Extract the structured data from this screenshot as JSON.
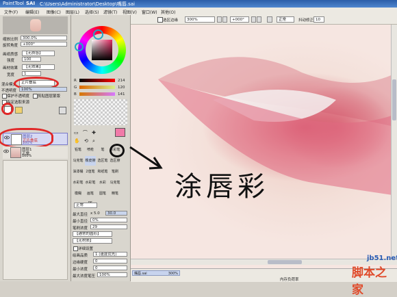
{
  "window": {
    "app": "PaintTool",
    "logo": "SAI",
    "title": "C:\\Users\\Administrator\\Desktop\\嘴唇.sai"
  },
  "menu": [
    "文件(F)",
    "编辑(E)",
    "图像(C)",
    "图层(L)",
    "选择(S)",
    "滤镜(T)",
    "视图(V)",
    "窗口(W)",
    "其他(O)"
  ],
  "toolbar": {
    "selection_check": "选区边缘",
    "zoom": "300%",
    "angle": "+000°",
    "mode": "正常",
    "stabilizer_label": "抖动修正",
    "stabilizer": "10"
  },
  "navigator": {
    "zoom_label": "缩放比例",
    "zoom_value": "300.0%",
    "angle_label": "旋转角度",
    "angle_value": "+000°"
  },
  "layer_props": {
    "paper_label": "画纸质感",
    "paper_value": "【无质感】",
    "strength_label": "强度",
    "strength_value": "100",
    "effect_label": "画材效果",
    "effect_value": "【无效果】",
    "width_label": "宽度",
    "width_value": "1",
    "blend_label": "混合模式",
    "blend_value": "正片叠底",
    "opacity_label": "不透明度",
    "opacity_value": "100%",
    "protect_label": "保护不透明度",
    "clip_label": "剪贴图层蒙版",
    "ref_label": "指定选取来源"
  },
  "layers": [
    {
      "name": "图层2",
      "mode": "正片叠底",
      "opacity": "100%"
    },
    {
      "name": "图层1",
      "mode": "正常",
      "opacity": "100%"
    }
  ],
  "color": {
    "accent": "#e05070",
    "r_label": "R",
    "r_value": "214",
    "g_label": "G",
    "g_value": "120",
    "b_label": "B",
    "b_value": "141"
  },
  "tools": [
    "铅笔",
    "喷枪",
    "笔",
    "水彩笔",
    "马克笔",
    "橡皮擦",
    "选区笔",
    "选区擦",
    "油漆桶",
    "2值笔",
    "和纸笔",
    "笔刷",
    "水彩笔",
    "水彩笔",
    "水彩",
    "马克笔",
    "模糊",
    "画笔PS",
    "圆笔",
    "精笔"
  ],
  "brush": {
    "mode_value": "正常",
    "size_label": "最大直径",
    "size_mult": "x 5.0",
    "size_value": "30.0",
    "min_label": "最小直径",
    "min_value": "0%",
    "density_label": "笔刷浓度",
    "density_value": "29",
    "shape_value": "【通常的圆形】",
    "texture_value": "【无材质】",
    "detail_label": "详细设置",
    "quality_label": "绘画品质",
    "quality_value": "1 (速度优先)",
    "edge_label": "边缘硬度",
    "edge_value": "0",
    "min_density_label": "最小浓度",
    "min_density_value": "0",
    "max_density_label": "最大浓度笔压",
    "max_density_value": "100%"
  },
  "status": {
    "file": "嘴唇.sai",
    "zoom": "300%",
    "memory": "内存负荷率"
  },
  "annotation": {
    "text": "涂唇彩"
  },
  "watermark": {
    "site": "jb51.net",
    "brand": "脚本之家"
  }
}
